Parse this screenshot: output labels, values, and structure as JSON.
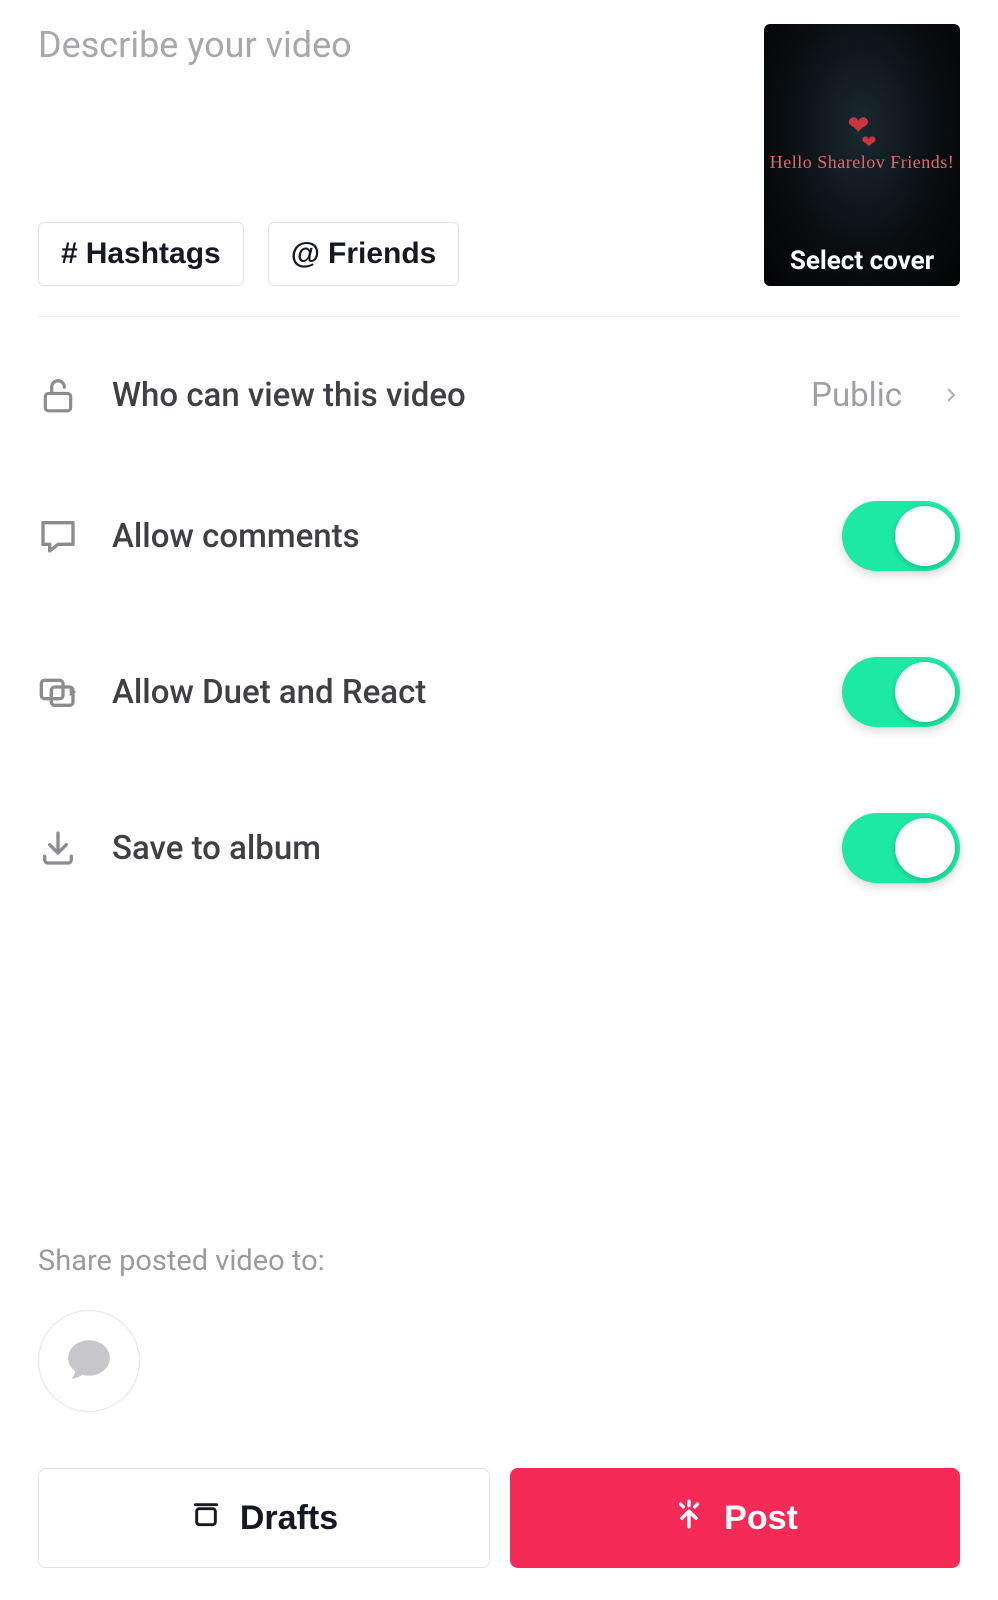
{
  "description": {
    "placeholder": "Describe your video",
    "value": ""
  },
  "chips": {
    "hashtags": "Hashtags",
    "friends": "Friends"
  },
  "cover": {
    "caption_text": "Hello Sharelov Friends!",
    "select_label": "Select cover"
  },
  "settings": {
    "privacy": {
      "label": "Who can view this video",
      "value": "Public"
    },
    "comments": {
      "label": "Allow comments",
      "on": true
    },
    "duet": {
      "label": "Allow Duet and React",
      "on": true
    },
    "save": {
      "label": "Save to album",
      "on": true
    }
  },
  "share": {
    "label": "Share posted video to:"
  },
  "buttons": {
    "drafts": "Drafts",
    "post": "Post"
  },
  "colors": {
    "accent": "#1de9a5",
    "primary": "#f62a57"
  }
}
